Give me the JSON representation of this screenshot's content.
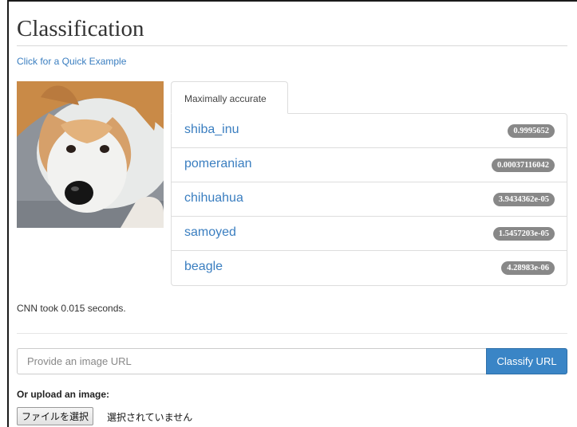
{
  "page": {
    "title": "Classification",
    "quick_example": "Click for a Quick Example"
  },
  "tab": {
    "label": "Maximally accurate"
  },
  "results": [
    {
      "label": "shiba_inu",
      "score": "0.9995652"
    },
    {
      "label": "pomeranian",
      "score": "0.00037116042"
    },
    {
      "label": "chihuahua",
      "score": "3.9434362e-05"
    },
    {
      "label": "samoyed",
      "score": "1.5457203e-05"
    },
    {
      "label": "beagle",
      "score": "4.28983e-06"
    }
  ],
  "timing": "CNN took 0.015 seconds.",
  "url_form": {
    "placeholder": "Provide an image URL",
    "button": "Classify URL"
  },
  "upload": {
    "label": "Or upload an image:",
    "button": "ファイルを選択",
    "status": "選択されていません"
  },
  "colors": {
    "link": "#3a7ec0",
    "badge": "#888888",
    "button": "#3a85c6"
  }
}
